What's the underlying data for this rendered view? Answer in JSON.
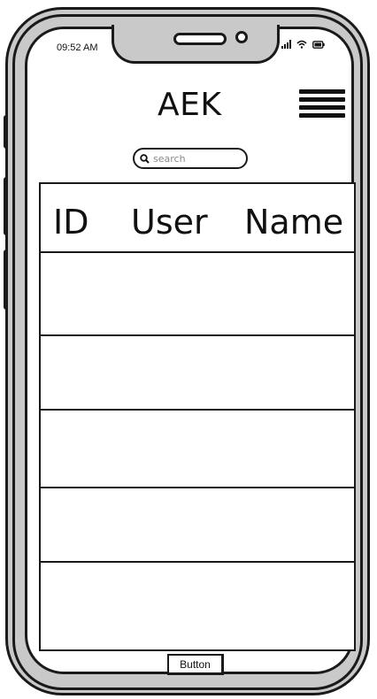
{
  "status_bar": {
    "time": "09:52 AM",
    "icons": [
      "signal-icon",
      "wifi-icon",
      "battery-icon"
    ]
  },
  "header": {
    "title": "AEK",
    "menu_icon": "hamburger-menu-icon"
  },
  "search": {
    "placeholder": "search",
    "value": "",
    "icon": "search-icon"
  },
  "table": {
    "columns": [
      "ID",
      "User",
      "Name"
    ],
    "rows": [
      [
        "",
        "",
        ""
      ],
      [
        "",
        "",
        ""
      ],
      [
        "",
        "",
        ""
      ],
      [
        "",
        "",
        ""
      ],
      [
        "",
        "",
        ""
      ]
    ]
  },
  "footer": {
    "button_label": "Button"
  },
  "colors": {
    "outline": "#1a1a1a",
    "phone_body": "#c9c9c9",
    "screen": "#ffffff"
  }
}
